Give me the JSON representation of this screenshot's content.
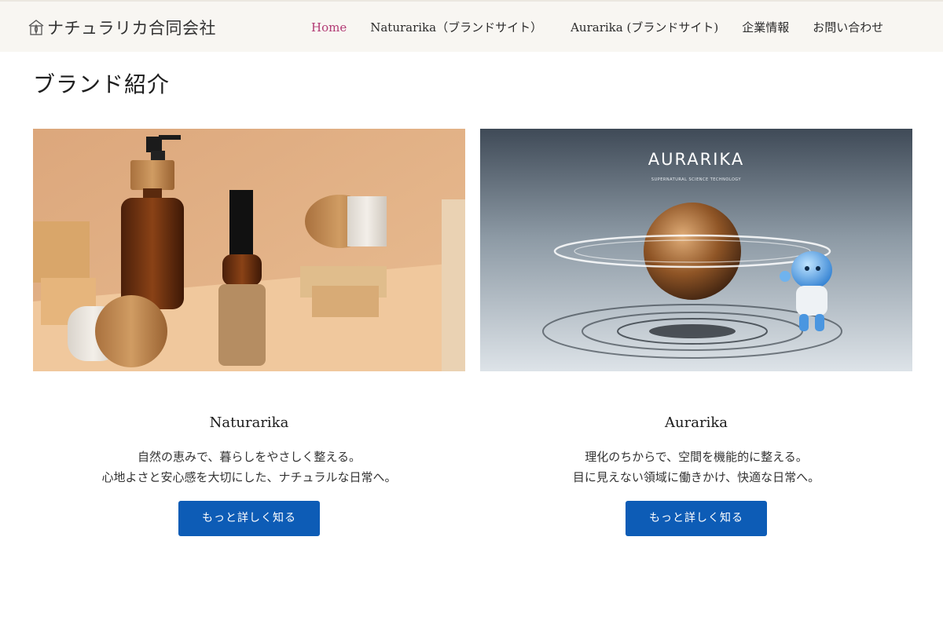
{
  "header": {
    "logo_text": "ナチュラリカ合同会社",
    "nav": [
      {
        "label": "Home",
        "active": true
      },
      {
        "label": "Naturarika（ブランドサイト）",
        "active": false
      },
      {
        "label": "Aurarika (ブランドサイト)",
        "active": false
      },
      {
        "label": "企業情報",
        "active": false
      },
      {
        "label": "お問い合わせ",
        "active": false
      }
    ],
    "active_color": "#b23a74"
  },
  "main": {
    "title": "ブランド紹介",
    "cards": [
      {
        "title": "Naturarika",
        "desc_lines": [
          "自然の恵みで、暮らしをやさしく整える。",
          "心地よさと安心感を大切にした、ナチュラルな日常へ。"
        ],
        "button_label": "もっと詳しく知る",
        "image": "cosmetic-bottles-photo"
      },
      {
        "title": "Aurarika",
        "desc_lines": [
          "理化のちからで、空間を機能的に整える。",
          "目に見えない領域に働きかけ、快適な日常へ。"
        ],
        "button_label": "もっと詳しく知る",
        "image": "aurarika-sphere-photo",
        "image_text": {
          "brand": "AURARIKA",
          "tagline": "SUPERNATURAL SCIENCE TECHNOLOGY"
        }
      }
    ],
    "button_color": "#0d5cb6"
  }
}
